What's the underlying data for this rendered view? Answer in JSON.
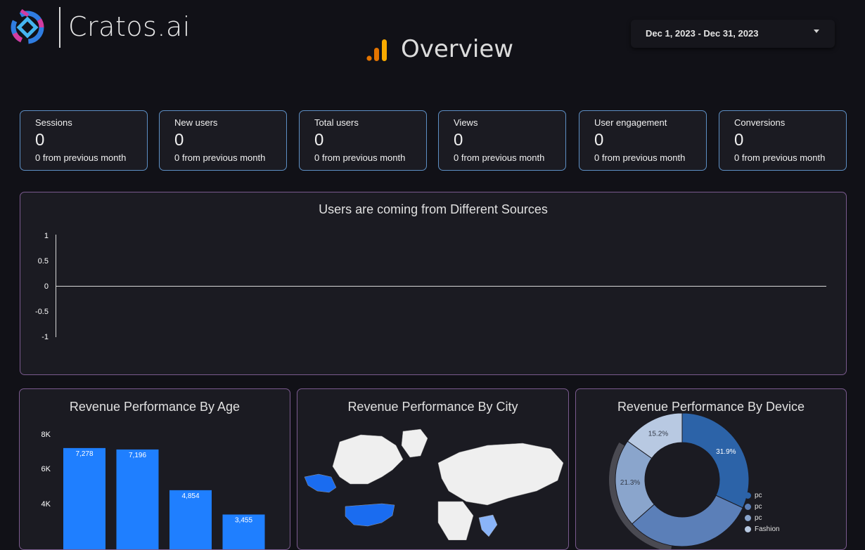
{
  "brand": {
    "name": "Cratos.ai"
  },
  "header": {
    "title": "Overview"
  },
  "date_range": {
    "label": "Dec 1, 2023 - Dec 31, 2023"
  },
  "kpis": [
    {
      "label": "Sessions",
      "value": "0",
      "sub": "0 from previous month"
    },
    {
      "label": "New users",
      "value": "0",
      "sub": "0 from previous month"
    },
    {
      "label": "Total users",
      "value": "0",
      "sub": "0 from previous month"
    },
    {
      "label": "Views",
      "value": "0",
      "sub": "0 from previous month"
    },
    {
      "label": "User engagement",
      "value": "0",
      "sub": "0 from previous month"
    },
    {
      "label": "Conversions",
      "value": "0",
      "sub": "0 from previous month"
    }
  ],
  "sources_chart": {
    "title": "Users are coming from Different Sources",
    "ticks": [
      "1",
      "0.5",
      "0",
      "-0.5",
      "-1"
    ]
  },
  "age_chart": {
    "title": "Revenue Performance By Age",
    "ticks": [
      "8K",
      "6K",
      "4K"
    ],
    "value_labels": [
      "7,278",
      "7,196",
      "4,854",
      "3,455"
    ]
  },
  "city_chart": {
    "title": "Revenue Performance By City"
  },
  "device_chart": {
    "title": "Revenue Performance By Device",
    "slice_labels": [
      "31.9%",
      "21.3%",
      "15.2%"
    ],
    "legend": [
      "pc",
      "pc",
      "pc",
      "Fashion"
    ]
  },
  "chart_data": [
    {
      "type": "line",
      "title": "Users are coming from Different Sources",
      "ylim": [
        -1,
        1
      ],
      "yticks": [
        1,
        0.5,
        0,
        -0.5,
        -1
      ],
      "series": []
    },
    {
      "type": "bar",
      "title": "Revenue Performance By Age",
      "categories": [
        "",
        "",
        "",
        ""
      ],
      "values": [
        7278,
        7196,
        4854,
        3455
      ],
      "yticks": [
        "8K",
        "6K",
        "4K"
      ],
      "ylim": [
        0,
        8000
      ],
      "color": "#1f7fff"
    },
    {
      "type": "pie",
      "title": "Revenue Performance By Device",
      "slices": [
        {
          "label": "31.9%",
          "value": 31.9,
          "color": "#2c63a8"
        },
        {
          "label": "",
          "value": 31.6,
          "color": "#5b7fb8"
        },
        {
          "label": "21.3%",
          "value": 21.3,
          "color": "#8aa5cc"
        },
        {
          "label": "15.2%",
          "value": 15.2,
          "color": "#b8c9e2"
        }
      ],
      "legend": [
        "pc",
        "pc",
        "pc",
        "Fashion"
      ],
      "legend_colors": [
        "#2c63a8",
        "#5b7fb8",
        "#8aa5cc",
        "#b8c9e2"
      ]
    }
  ]
}
